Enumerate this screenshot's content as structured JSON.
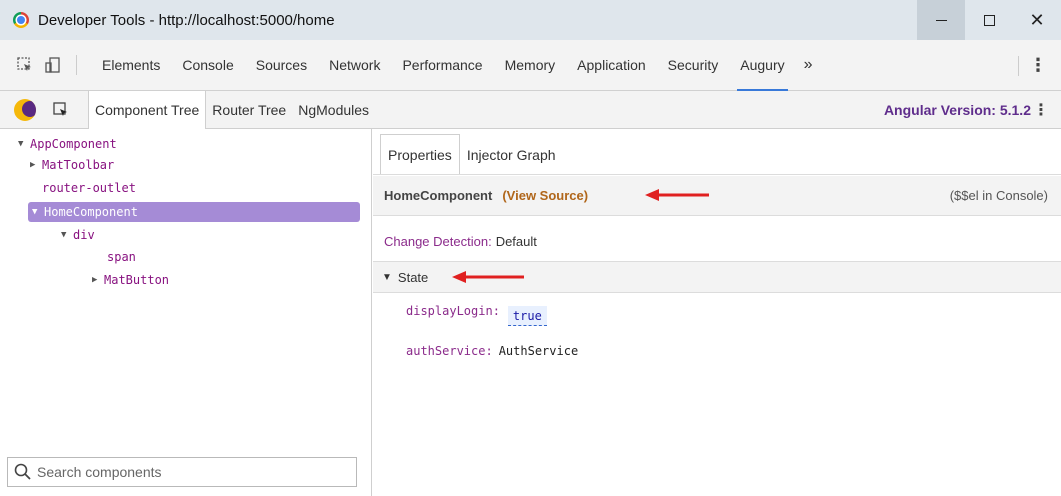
{
  "window": {
    "title": "Developer Tools - http://localhost:5000/home",
    "controls": {
      "minimize": "—",
      "maximize": "☐",
      "close": "✕"
    }
  },
  "devtools_tabs": [
    {
      "label": "Elements"
    },
    {
      "label": "Console"
    },
    {
      "label": "Sources"
    },
    {
      "label": "Network"
    },
    {
      "label": "Performance"
    },
    {
      "label": "Memory"
    },
    {
      "label": "Application"
    },
    {
      "label": "Security"
    },
    {
      "label": "Augury",
      "active": true
    }
  ],
  "devtools_more": "»",
  "devtools_menu": "⋮",
  "augury": {
    "tabs": [
      {
        "label": "Component Tree",
        "active": true
      },
      {
        "label": "Router Tree"
      },
      {
        "label": "NgModules"
      }
    ],
    "version": "Angular Version: 5.1.2",
    "menu": "⋮"
  },
  "tree": {
    "nodes": [
      {
        "arrow": "▼",
        "label": "AppComponent"
      },
      {
        "arrow": "▶",
        "label": "MatToolbar"
      },
      {
        "arrow": "",
        "label": "router-outlet"
      },
      {
        "arrow": "▼",
        "label": "HomeComponent",
        "selected": true
      },
      {
        "arrow": "▼",
        "label": "div"
      },
      {
        "arrow": "",
        "label": "span"
      },
      {
        "arrow": "▶",
        "label": "MatButton"
      }
    ],
    "search_placeholder": "Search components"
  },
  "properties": {
    "subtabs": [
      {
        "label": "Properties",
        "active": true
      },
      {
        "label": "Injector Graph"
      }
    ],
    "component_name": "HomeComponent",
    "view_source": "(View Source)",
    "console_hint": "($$el in Console)",
    "change_detection_label": "Change Detection:",
    "change_detection_value": "Default",
    "state_caret": "▼",
    "state_label": "State",
    "state": [
      {
        "key": "displayLogin:",
        "value": "true",
        "kind": "boolean"
      },
      {
        "key": "authService:",
        "value": "AuthService",
        "kind": "object"
      }
    ]
  },
  "colors": {
    "accent": "#3879d9",
    "angular_version": "#5f2d8c",
    "selected_node": "#a58bd6",
    "view_source": "#b0661a",
    "annotation_arrow": "#e02020"
  }
}
